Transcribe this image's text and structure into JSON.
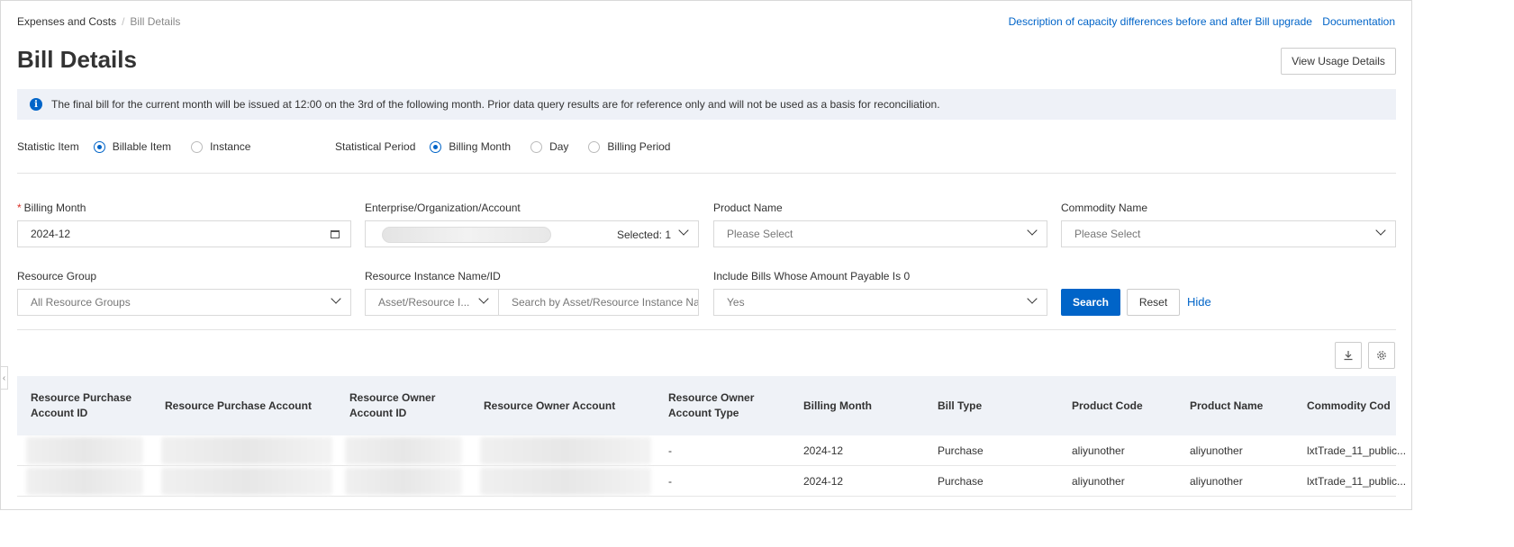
{
  "breadcrumb": {
    "root": "Expenses and Costs",
    "separator": "/",
    "current": "Bill Details"
  },
  "top_links": {
    "capacity": "Description of capacity differences before and after Bill upgrade",
    "docs": "Documentation"
  },
  "page_title": "Bill Details",
  "view_usage_label": "View Usage Details",
  "notice": {
    "icon": "info-icon",
    "text": "The final bill for the current month will be issued at 12:00 on the 3rd of the following month. Prior data query results are for reference only and will not be used as a basis for reconciliation."
  },
  "statistic_item": {
    "label": "Statistic Item",
    "options": [
      "Billable Item",
      "Instance"
    ],
    "selected": "Billable Item"
  },
  "statistical_period": {
    "label": "Statistical Period",
    "options": [
      "Billing Month",
      "Day",
      "Billing Period"
    ],
    "selected": "Billing Month"
  },
  "filters": {
    "billing_month": {
      "label": "Billing Month",
      "required_mark": "*",
      "value": "2024-12"
    },
    "account": {
      "label": "Enterprise/Organization/Account",
      "selected_text": "Selected: 1"
    },
    "product_name": {
      "label": "Product Name",
      "placeholder": "Please Select"
    },
    "commodity_name": {
      "label": "Commodity Name",
      "placeholder": "Please Select"
    },
    "resource_group": {
      "label": "Resource Group",
      "value": "All Resource Groups"
    },
    "resource_instance": {
      "label": "Resource Instance Name/ID",
      "type_value": "Asset/Resource I...",
      "search_placeholder": "Search by Asset/Resource Instance Nar"
    },
    "include_zero": {
      "label": "Include Bills Whose Amount Payable Is 0",
      "value": "Yes"
    }
  },
  "actions": {
    "search": "Search",
    "reset": "Reset",
    "hide": "Hide"
  },
  "table": {
    "columns": [
      "Resource Purchase Account ID",
      "Resource Purchase Account",
      "Resource Owner Account ID",
      "Resource Owner Account",
      "Resource Owner Account Type",
      "Billing Month",
      "Bill Type",
      "Product Code",
      "Product Name",
      "Commodity Cod"
    ],
    "rows": [
      {
        "owner_account_type": "-",
        "billing_month": "2024-12",
        "bill_type": "Purchase",
        "product_code": "aliyunother",
        "product_name": "aliyunother",
        "commodity_code": "lxtTrade_11_public..."
      },
      {
        "owner_account_type": "-",
        "billing_month": "2024-12",
        "bill_type": "Purchase",
        "product_code": "aliyunother",
        "product_name": "aliyunother",
        "commodity_code": "lxtTrade_11_public..."
      }
    ]
  }
}
